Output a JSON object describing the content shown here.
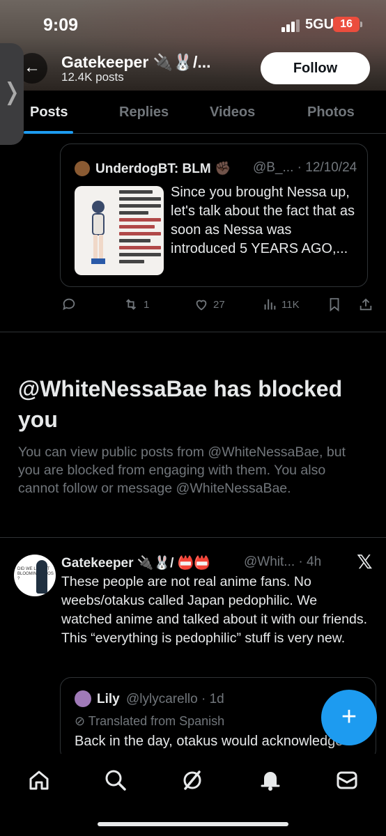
{
  "status_bar": {
    "time": "9:09",
    "network": "5GUC",
    "battery": "16"
  },
  "header": {
    "title": "Gatekeeper 🔌🐰/...",
    "post_count": "12.4K posts",
    "follow_label": "Follow"
  },
  "tabs": [
    {
      "label": "Posts",
      "active": true
    },
    {
      "label": "Replies",
      "active": false
    },
    {
      "label": "Videos",
      "active": false
    },
    {
      "label": "Photos",
      "active": false
    }
  ],
  "quoted_post": {
    "author": "UnderdogBT: BLM ✊🏿",
    "handle_date": "@B_... · 12/10/24",
    "text": "Since you brought Nessa up, let's talk about the fact that as soon as Nessa was introduced 5 YEARS AGO,..."
  },
  "actions": {
    "retweets": "1",
    "likes": "27",
    "views": "11K"
  },
  "blocked": {
    "title": "@WhiteNessaBae has blocked you",
    "description": "You can view public posts from @WhiteNessaBae, but you are blocked from engaging with them. You also cannot follow or message @WhiteNessaBae."
  },
  "tweet": {
    "author": "Gatekeeper 🔌🐰/ 📛📛",
    "handle_time": "@Whit... · 4h",
    "avatar_text": "DID WE LOSE IT BLOOMIN' CHAOS ?",
    "text": "These people are not real anime fans. No weebs/otakus called Japan pedophilic. We watched anime and talked about it with our friends. This “everything is pedophilic” stuff is very new."
  },
  "quoted_post_2": {
    "author": "Lily",
    "handle_time": "@lylycarello · 1d",
    "translated": "Translated from Spanish",
    "text": "Back in the day, otakus would acknowledge"
  },
  "colors": {
    "accent": "#1d9bf0",
    "background": "#000000",
    "muted": "#71767b",
    "text": "#e7e9ea",
    "border": "#2f3336"
  },
  "icons": [
    "back-arrow-icon",
    "reply-icon",
    "retweet-icon",
    "heart-icon",
    "views-icon",
    "bookmark-icon",
    "share-icon",
    "x-logo-icon",
    "compose-icon",
    "home-icon",
    "search-icon",
    "grok-icon",
    "bell-icon",
    "messages-icon"
  ]
}
